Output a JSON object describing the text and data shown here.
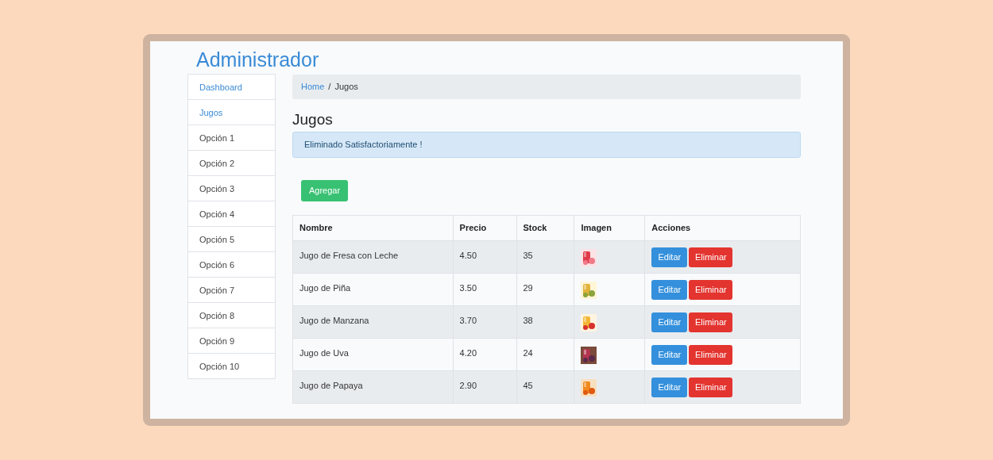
{
  "title": "Administrador",
  "sidebar": {
    "items": [
      {
        "label": "Dashboard",
        "kind": "link"
      },
      {
        "label": "Jugos",
        "kind": "link"
      },
      {
        "label": "Opción 1",
        "kind": "option"
      },
      {
        "label": "Opción 2",
        "kind": "option"
      },
      {
        "label": "Opción 3",
        "kind": "option"
      },
      {
        "label": "Opción 4",
        "kind": "option"
      },
      {
        "label": "Opción 5",
        "kind": "option"
      },
      {
        "label": "Opción 6",
        "kind": "option"
      },
      {
        "label": "Opción 7",
        "kind": "option"
      },
      {
        "label": "Opción 8",
        "kind": "option"
      },
      {
        "label": "Opción 9",
        "kind": "option"
      },
      {
        "label": "Opción 10",
        "kind": "option"
      }
    ]
  },
  "breadcrumb": [
    {
      "label": "Home",
      "kind": "link"
    },
    {
      "label": "/",
      "kind": "separator"
    },
    {
      "label": "Jugos",
      "kind": "current"
    }
  ],
  "heading": "Jugos",
  "alert": "Eliminado Satisfactoriamente !",
  "add_button": "Agregar",
  "table": {
    "columns": [
      "Nombre",
      "Precio",
      "Stock",
      "Imagen",
      "Acciones"
    ],
    "rows": [
      {
        "nombre": "Jugo de Fresa con Leche",
        "precio": "4.50",
        "stock": "35",
        "imagen": {
          "kind": "picture"
        },
        "actions": [
          "Editar",
          "Eliminar"
        ]
      },
      {
        "nombre": "Jugo de Piña",
        "precio": "3.50",
        "stock": "29",
        "imagen": {
          "kind": "picture"
        },
        "actions": [
          "Editar",
          "Eliminar"
        ]
      },
      {
        "nombre": "Jugo de Manzana",
        "precio": "3.70",
        "stock": "38",
        "imagen": {
          "kind": "picture"
        },
        "actions": [
          "Editar",
          "Eliminar"
        ]
      },
      {
        "nombre": "Jugo de Uva",
        "precio": "4.20",
        "stock": "24",
        "imagen": {
          "kind": "picture"
        },
        "actions": [
          "Editar",
          "Eliminar"
        ]
      },
      {
        "nombre": "Jugo de Papaya",
        "precio": "2.90",
        "stock": "45",
        "imagen": {
          "kind": "picture"
        },
        "actions": [
          "Editar",
          "Eliminar"
        ]
      }
    ]
  }
}
